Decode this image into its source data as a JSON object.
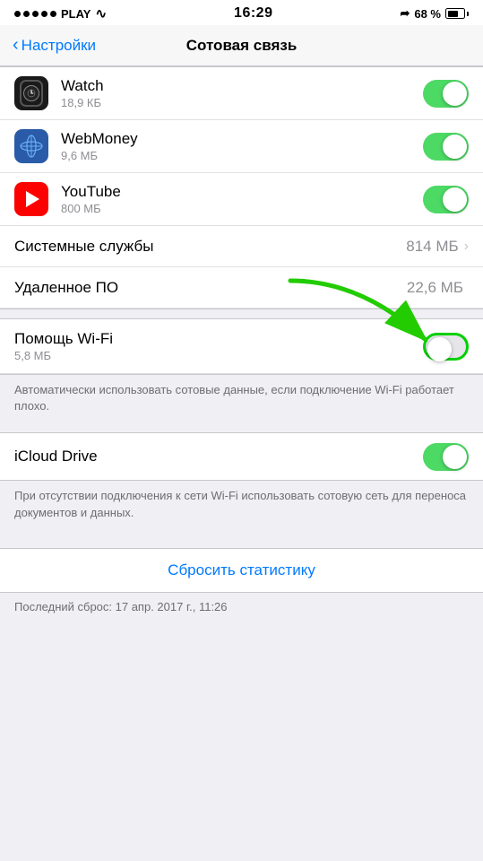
{
  "statusBar": {
    "carrier": "PLAY",
    "time": "16:29",
    "battery": "68 %",
    "locationArrow": "↗"
  },
  "navBar": {
    "backLabel": "Настройки",
    "title": "Сотовая связь"
  },
  "apps": [
    {
      "name": "Watch",
      "subtitle": "18,9 КБ",
      "icon": "watch",
      "toggleOn": true
    },
    {
      "name": "WebMoney",
      "subtitle": "9,6 МБ",
      "icon": "webmoney",
      "toggleOn": true
    },
    {
      "name": "YouTube",
      "subtitle": "800 МБ",
      "icon": "youtube",
      "toggleOn": true
    }
  ],
  "systemServices": {
    "label": "Системные службы",
    "value": "814 МБ"
  },
  "remoteAccess": {
    "label": "Удаленное ПО",
    "value": "22,6 МБ"
  },
  "wifiAssist": {
    "title": "Помощь Wi-Fi",
    "subtitle": "5,8 МБ",
    "toggleOn": false,
    "description": "Автоматически использовать сотовые данные, если подключение Wi-Fi работает плохо."
  },
  "icloudDrive": {
    "title": "iCloud Drive",
    "toggleOn": true,
    "description": "При отсутствии подключения к сети Wi-Fi использовать сотовую сеть для переноса документов и данных."
  },
  "resetStats": {
    "buttonLabel": "Сбросить статистику",
    "lastReset": "Последний сброс: 17 апр. 2017 г., 11:26"
  }
}
